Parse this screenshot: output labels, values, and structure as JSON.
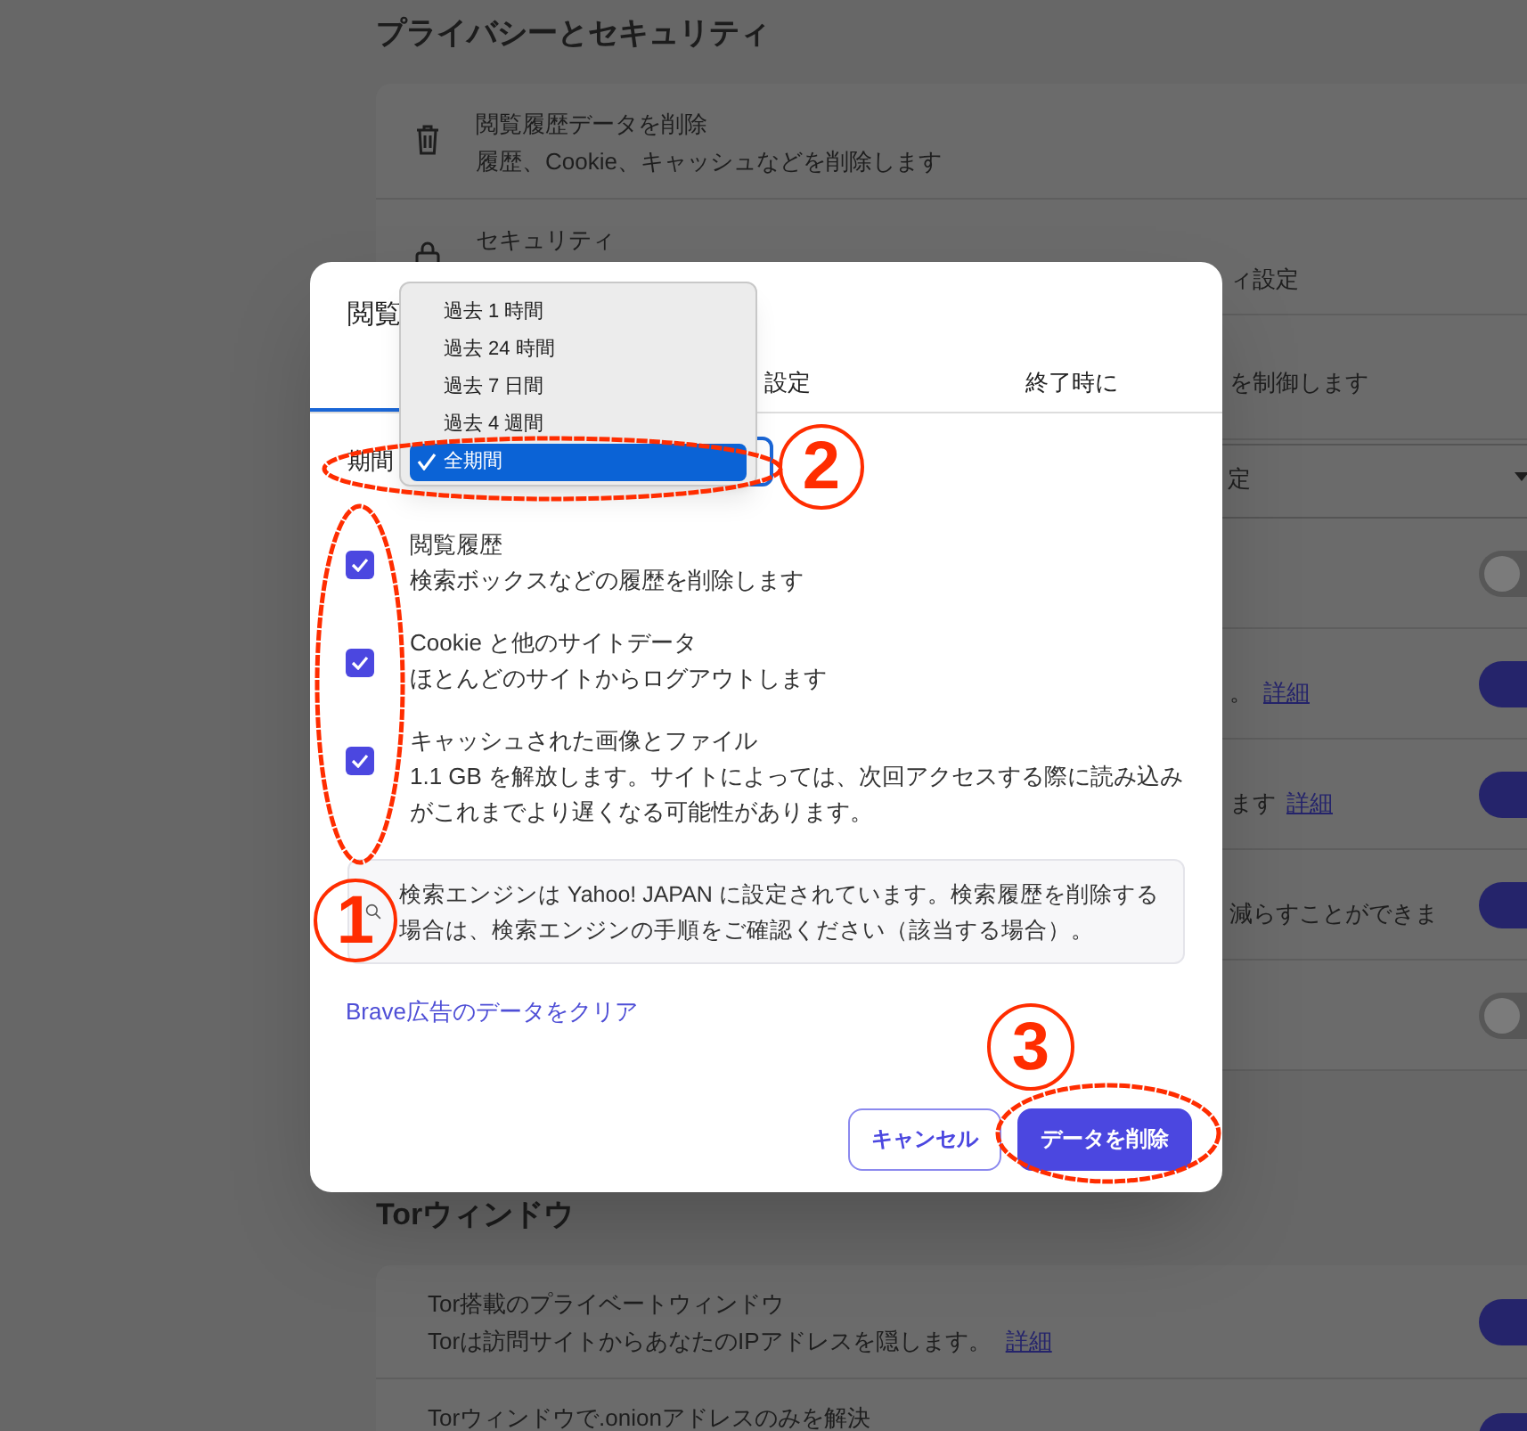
{
  "background_page": {
    "sections": [
      {
        "heading": "プライバシーとセキュリティ",
        "rows": [
          {
            "kind": "action",
            "title": "閲覧履歴データを削除",
            "description": "履歴、Cookie、キャッシュなどを削除します"
          },
          {
            "kind": "action",
            "title": "セキュリティ",
            "fragment": "ィ設定"
          },
          {
            "kind": "text",
            "fragment": "を制御します"
          },
          {
            "kind": "select",
            "fragment": "定"
          },
          {
            "kind": "toggle",
            "on": false
          },
          {
            "kind": "toggle",
            "on": true,
            "fragment": "。",
            "link": "詳細"
          },
          {
            "kind": "toggle",
            "on": true,
            "fragment": "ます",
            "link": "詳細"
          },
          {
            "kind": "toggle",
            "on": true,
            "fragment": "減らすことができま"
          },
          {
            "kind": "toggle",
            "on": false
          }
        ]
      },
      {
        "heading": "Torウィンドウ",
        "rows": [
          {
            "kind": "toggle",
            "on": true,
            "title": "Tor搭載のプライベートウィンドウ",
            "description": "Torは訪問サイトからあなたのIPアドレスを隠します。",
            "link": "詳細"
          },
          {
            "kind": "toggle",
            "on": true,
            "title": "Torウィンドウで.onionアドレスのみを解決"
          }
        ]
      }
    ]
  },
  "dialog": {
    "title": "閲覧",
    "tabs": [
      {
        "selected": true
      },
      {
        "label": "設定",
        "selected": false
      },
      {
        "label": "終了時に",
        "selected": false
      }
    ],
    "period": {
      "label": "期間",
      "options": [
        {
          "label": "過去 1 時間",
          "selected": false
        },
        {
          "label": "過去 24 時間",
          "selected": false
        },
        {
          "label": "過去 7 日間",
          "selected": false
        },
        {
          "label": "過去 4 週間",
          "selected": false
        },
        {
          "label": "全期間",
          "selected": true
        }
      ]
    },
    "items": [
      {
        "title": "閲覧履歴",
        "description": "検索ボックスなどの履歴を削除します",
        "checked": true
      },
      {
        "title": "Cookie と他のサイトデータ",
        "description": "ほとんどのサイトからログアウトします",
        "checked": true
      },
      {
        "title": "キャッシュされた画像とファイル",
        "description": "1.1 GB を解放します。サイトによっては、次回アクセスする際に読み込みがこれまでより遅くなる可能性があります。",
        "checked": true
      }
    ],
    "notice": "検索エンジンは Yahoo! JAPAN に設定されています。検索履歴を削除する場合は、検索エンジンの手順をご確認ください（該当する場合）。",
    "link": "Brave広告のデータをクリア",
    "buttons": [
      {
        "kind": "secondary",
        "label": "キャンセル"
      },
      {
        "kind": "primary",
        "label": "データを削除"
      }
    ]
  },
  "annotations": [
    {
      "label": "1"
    },
    {
      "label": "2"
    },
    {
      "label": "3"
    }
  ]
}
